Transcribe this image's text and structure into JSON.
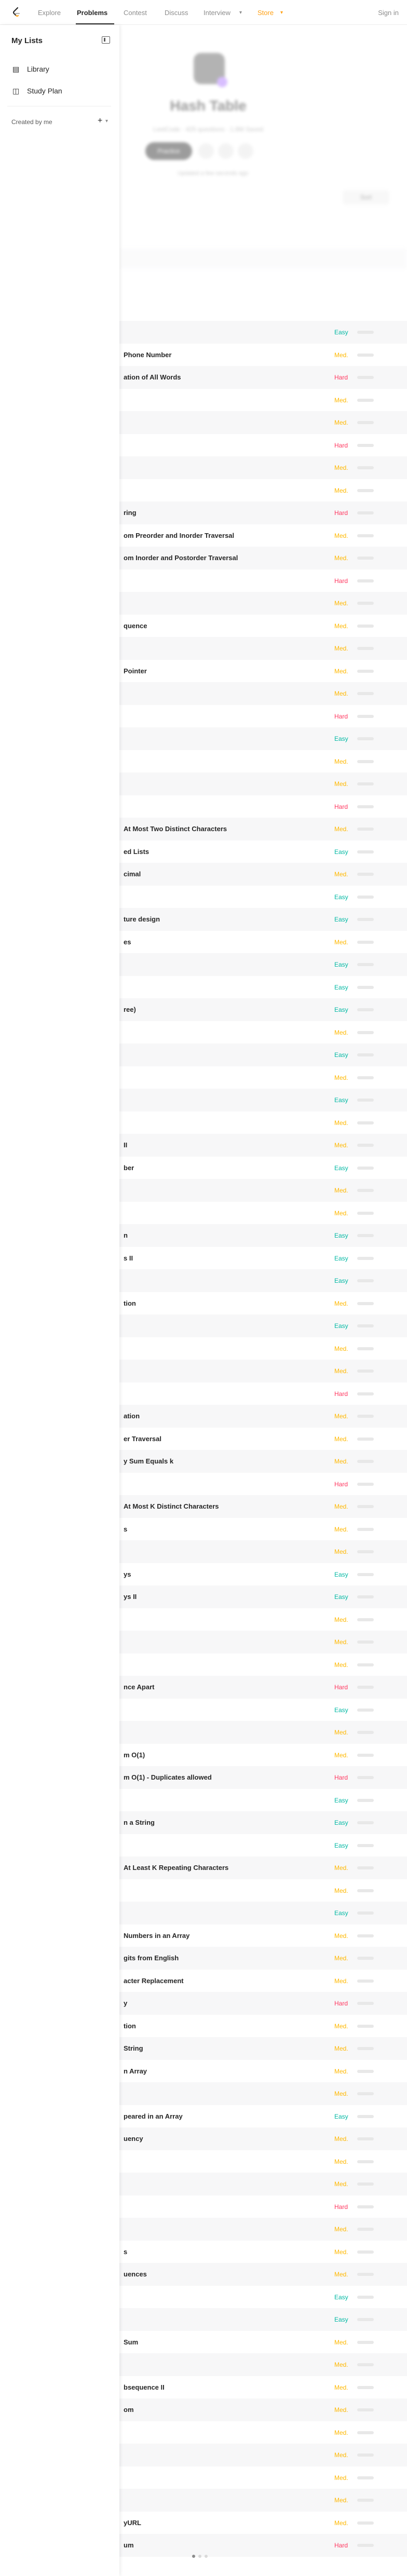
{
  "nav": {
    "links": [
      "Explore",
      "Problems",
      "Contest",
      "Discuss",
      "Interview",
      "Store"
    ],
    "signin": "Sign in"
  },
  "sidebar": {
    "title": "My Lists",
    "items": [
      {
        "label": "Library",
        "icon": "book-icon"
      },
      {
        "label": "Study Plan",
        "icon": "study-plan-icon"
      }
    ],
    "created_by_me": "Created by me"
  },
  "hero": {
    "title": "Hash Table",
    "meta": "LeetCode · 425 questions · 1.8M Saved",
    "practice_label": "Practice",
    "note": "Updated a few seconds ago",
    "sort_label": "Sort"
  },
  "colors": {
    "easy": "#00b8a3",
    "medium": "#ffb800",
    "hard": "#ff375f",
    "accent": "#ffa116"
  },
  "rows": [
    {
      "title": "",
      "difficulty": "Easy"
    },
    {
      "title": "Phone Number",
      "difficulty": "Med."
    },
    {
      "title": "ation of All Words",
      "difficulty": "Hard"
    },
    {
      "title": "",
      "difficulty": "Med."
    },
    {
      "title": "",
      "difficulty": "Med."
    },
    {
      "title": "",
      "difficulty": "Hard"
    },
    {
      "title": "",
      "difficulty": "Med."
    },
    {
      "title": "",
      "difficulty": "Med."
    },
    {
      "title": "ring",
      "difficulty": "Hard"
    },
    {
      "title": "om Preorder and Inorder Traversal",
      "difficulty": "Med."
    },
    {
      "title": "om Inorder and Postorder Traversal",
      "difficulty": "Med."
    },
    {
      "title": "",
      "difficulty": "Hard"
    },
    {
      "title": "",
      "difficulty": "Med."
    },
    {
      "title": "quence",
      "difficulty": "Med."
    },
    {
      "title": "",
      "difficulty": "Med."
    },
    {
      "title": "Pointer",
      "difficulty": "Med."
    },
    {
      "title": "",
      "difficulty": "Med."
    },
    {
      "title": "",
      "difficulty": "Hard"
    },
    {
      "title": "",
      "difficulty": "Easy"
    },
    {
      "title": "",
      "difficulty": "Med."
    },
    {
      "title": "",
      "difficulty": "Med."
    },
    {
      "title": "",
      "difficulty": "Hard"
    },
    {
      "title": "At Most Two Distinct Characters",
      "difficulty": "Med."
    },
    {
      "title": "ed Lists",
      "difficulty": "Easy"
    },
    {
      "title": "cimal",
      "difficulty": "Med."
    },
    {
      "title": "",
      "difficulty": "Easy"
    },
    {
      "title": "ture design",
      "difficulty": "Easy"
    },
    {
      "title": "es",
      "difficulty": "Med."
    },
    {
      "title": "",
      "difficulty": "Easy"
    },
    {
      "title": "",
      "difficulty": "Easy"
    },
    {
      "title": "ree)",
      "difficulty": "Easy"
    },
    {
      "title": "",
      "difficulty": "Med."
    },
    {
      "title": "",
      "difficulty": "Easy"
    },
    {
      "title": "",
      "difficulty": "Med."
    },
    {
      "title": "",
      "difficulty": "Easy"
    },
    {
      "title": "",
      "difficulty": "Med."
    },
    {
      "title": "II",
      "difficulty": "Med."
    },
    {
      "title": "ber",
      "difficulty": "Easy"
    },
    {
      "title": "",
      "difficulty": "Med."
    },
    {
      "title": "",
      "difficulty": "Med."
    },
    {
      "title": "n",
      "difficulty": "Easy"
    },
    {
      "title": "s II",
      "difficulty": "Easy"
    },
    {
      "title": "",
      "difficulty": "Easy"
    },
    {
      "title": "tion",
      "difficulty": "Med."
    },
    {
      "title": "",
      "difficulty": "Easy"
    },
    {
      "title": "",
      "difficulty": "Med."
    },
    {
      "title": "",
      "difficulty": "Med."
    },
    {
      "title": "",
      "difficulty": "Hard"
    },
    {
      "title": "ation",
      "difficulty": "Med."
    },
    {
      "title": "er Traversal",
      "difficulty": "Med."
    },
    {
      "title": "y Sum Equals k",
      "difficulty": "Med."
    },
    {
      "title": "",
      "difficulty": "Hard"
    },
    {
      "title": "At Most K Distinct Characters",
      "difficulty": "Med."
    },
    {
      "title": "s",
      "difficulty": "Med."
    },
    {
      "title": "",
      "difficulty": "Med."
    },
    {
      "title": "ys",
      "difficulty": "Easy"
    },
    {
      "title": "ys II",
      "difficulty": "Easy"
    },
    {
      "title": "",
      "difficulty": "Med."
    },
    {
      "title": "",
      "difficulty": "Med."
    },
    {
      "title": "",
      "difficulty": "Med."
    },
    {
      "title": "nce Apart",
      "difficulty": "Hard"
    },
    {
      "title": "",
      "difficulty": "Easy"
    },
    {
      "title": "",
      "difficulty": "Med."
    },
    {
      "title": "m O(1)",
      "difficulty": "Med."
    },
    {
      "title": "m O(1) - Duplicates allowed",
      "difficulty": "Hard"
    },
    {
      "title": "",
      "difficulty": "Easy"
    },
    {
      "title": "n a String",
      "difficulty": "Easy"
    },
    {
      "title": "",
      "difficulty": "Easy"
    },
    {
      "title": "At Least K Repeating Characters",
      "difficulty": "Med."
    },
    {
      "title": "",
      "difficulty": "Med."
    },
    {
      "title": "",
      "difficulty": "Easy"
    },
    {
      "title": "Numbers in an Array",
      "difficulty": "Med."
    },
    {
      "title": "gits from English",
      "difficulty": "Med."
    },
    {
      "title": "acter Replacement",
      "difficulty": "Med."
    },
    {
      "title": "y",
      "difficulty": "Hard"
    },
    {
      "title": "tion",
      "difficulty": "Med."
    },
    {
      "title": "String",
      "difficulty": "Med."
    },
    {
      "title": "n Array",
      "difficulty": "Med."
    },
    {
      "title": "",
      "difficulty": "Med."
    },
    {
      "title": "peared in an Array",
      "difficulty": "Easy"
    },
    {
      "title": "uency",
      "difficulty": "Med."
    },
    {
      "title": "",
      "difficulty": "Med."
    },
    {
      "title": "",
      "difficulty": "Med."
    },
    {
      "title": "",
      "difficulty": "Hard"
    },
    {
      "title": "",
      "difficulty": "Med."
    },
    {
      "title": "s",
      "difficulty": "Med."
    },
    {
      "title": "uences",
      "difficulty": "Med."
    },
    {
      "title": "",
      "difficulty": "Easy"
    },
    {
      "title": "",
      "difficulty": "Easy"
    },
    {
      "title": "Sum",
      "difficulty": "Med."
    },
    {
      "title": "",
      "difficulty": "Med."
    },
    {
      "title": "bsequence II",
      "difficulty": "Med."
    },
    {
      "title": "om",
      "difficulty": "Med."
    },
    {
      "title": "",
      "difficulty": "Med."
    },
    {
      "title": "",
      "difficulty": "Med."
    },
    {
      "title": "",
      "difficulty": "Med."
    },
    {
      "title": "",
      "difficulty": "Med."
    },
    {
      "title": "yURL",
      "difficulty": "Med."
    },
    {
      "title": "um",
      "difficulty": "Hard"
    }
  ]
}
